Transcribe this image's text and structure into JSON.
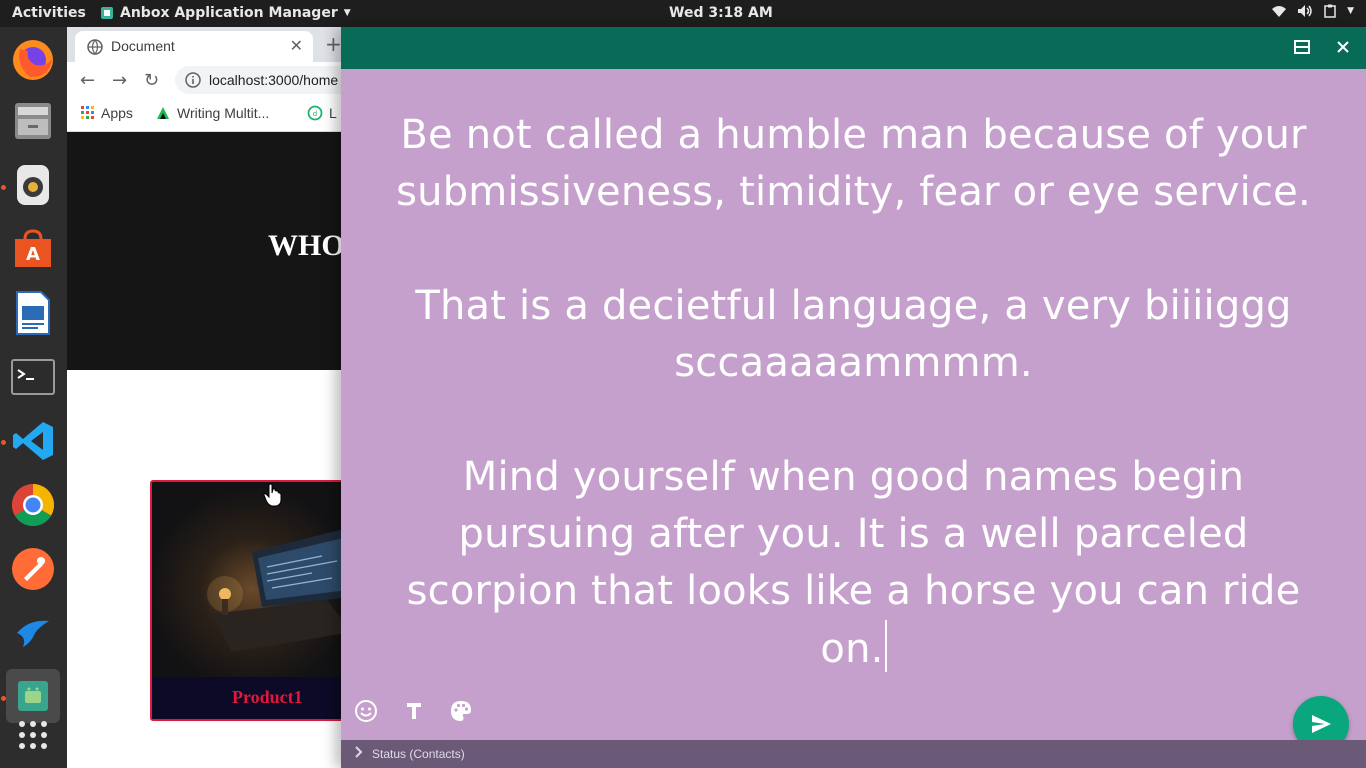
{
  "topbar": {
    "activities": "Activities",
    "app_name": "Anbox Application Manager",
    "clock": "Wed  3:18 AM"
  },
  "dock": {
    "items": [
      "firefox-icon",
      "files-icon",
      "rhythmbox-icon",
      "software-center-icon",
      "libreoffice-writer-icon",
      "terminal-icon",
      "vscode-icon",
      "chrome-icon",
      "postman-icon",
      "bird-app-icon",
      "anbox-icon",
      "show-applications-icon"
    ]
  },
  "browser": {
    "tab_title": "Document",
    "url": "localhost:3000/home",
    "bookmarks": {
      "apps": "Apps",
      "writing": "Writing Multit...",
      "third": "L"
    },
    "hero_heading": "WHO",
    "product_label": "Product1"
  },
  "status_editor": {
    "text": "Be not called a humble man because of your submissiveness, timidity, fear or eye service.\n\nThat is a decietful language, a very biiiiggg sccaaaaammmm.\n\nMind yourself when good names begin pursuing after you. It is a well parceled scorpion that looks like a horse you can ride on.",
    "background_color": "#c6a0cc",
    "accent_color": "#0aa67e",
    "titlebar_color": "#086b57",
    "statusbar_label": "Status (Contacts)"
  }
}
